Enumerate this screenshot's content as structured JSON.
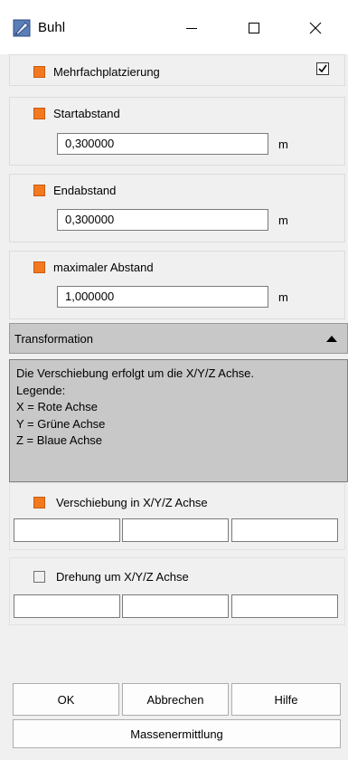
{
  "window": {
    "title": "Buhl"
  },
  "options": {
    "mehrfach": {
      "label": "Mehrfachplatzierung",
      "checked": true
    },
    "start": {
      "label": "Startabstand",
      "value": "0,300000",
      "unit": "m"
    },
    "end": {
      "label": "Endabstand",
      "value": "0,300000",
      "unit": "m"
    },
    "max": {
      "label": "maximaler Abstand",
      "value": "1,000000",
      "unit": "m"
    }
  },
  "transformation": {
    "title": "Transformation",
    "info": {
      "line1": "Die Verschiebung erfolgt um die X/Y/Z Achse.",
      "line2": "Legende:",
      "line3": "X = Rote Achse",
      "line4": "Y = Grüne Achse",
      "line5": "Z = Blaue Achse"
    },
    "verschiebung": {
      "label": "Verschiebung in X/Y/Z Achse",
      "x": "",
      "y": "",
      "z": ""
    },
    "drehung": {
      "label": "Drehung um X/Y/Z Achse",
      "x": "",
      "y": "",
      "z": ""
    }
  },
  "buttons": {
    "ok": "OK",
    "cancel": "Abbrechen",
    "help": "Hilfe",
    "mass": "Massenermittlung"
  },
  "colors": {
    "active_square": "#f37920",
    "panel": "#c8c8c8"
  }
}
